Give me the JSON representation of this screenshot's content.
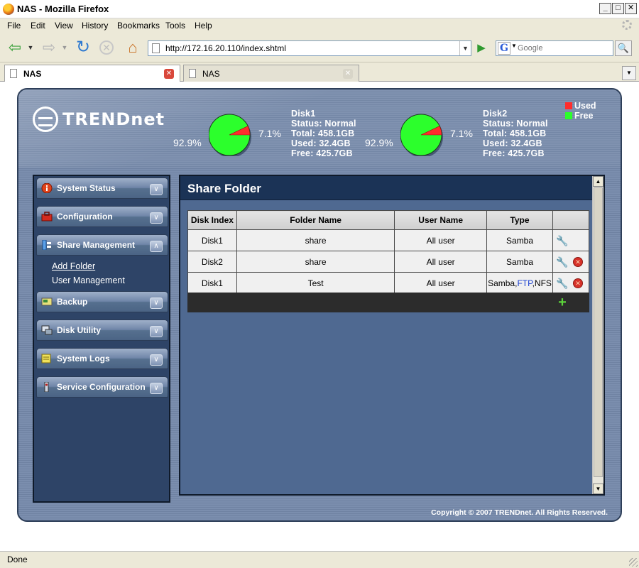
{
  "window": {
    "title": "NAS - Mozilla Firefox",
    "min": "_",
    "max": "□",
    "close": "✕"
  },
  "menu": [
    "File",
    "Edit",
    "View",
    "History",
    "Bookmarks",
    "Tools",
    "Help"
  ],
  "nav": {
    "url": "http://172.16.20.110/index.shtml",
    "search_placeholder": "Google"
  },
  "tabs": [
    {
      "label": "NAS",
      "active": true
    },
    {
      "label": "NAS",
      "active": false
    }
  ],
  "status": {
    "text": "Done"
  },
  "app": {
    "brand": "TRENDnet",
    "legend": {
      "used": "Used",
      "free": "Free"
    },
    "colors": {
      "used": "#ff2d2d",
      "free": "#2cff2c",
      "title_bar": "#1b3356",
      "panel": "#4f6991"
    },
    "disks": [
      {
        "name": "Disk1",
        "status": "Status: Normal",
        "total": "Total: 458.1GB",
        "used": "Used: 32.4GB",
        "free": "Free: 425.7GB",
        "used_pct": 7.1,
        "free_pct": 92.9,
        "used_label": "7.1%",
        "free_label": "92.9%"
      },
      {
        "name": "Disk2",
        "status": "Status: Normal",
        "total": "Total: 458.1GB",
        "used": "Used: 32.4GB",
        "free": "Free: 425.7GB",
        "used_pct": 7.1,
        "free_pct": 92.9,
        "used_label": "7.1%",
        "free_label": "92.9%"
      }
    ],
    "sidebar": {
      "items": [
        {
          "label": "System Status",
          "icon": "info-icon",
          "expanded": false
        },
        {
          "label": "Configuration",
          "icon": "toolbox-icon",
          "expanded": false
        },
        {
          "label": "Share Management",
          "icon": "share-icon",
          "expanded": true
        },
        {
          "label": "Backup",
          "icon": "backup-icon",
          "expanded": false
        },
        {
          "label": "Disk Utility",
          "icon": "disk-utility-icon",
          "expanded": false
        },
        {
          "label": "System Logs",
          "icon": "logs-icon",
          "expanded": false
        },
        {
          "label": "Service Configuration",
          "icon": "service-icon",
          "expanded": false
        }
      ],
      "submenu": [
        "Add Folder",
        "User Management"
      ]
    },
    "main": {
      "title": "Share Folder",
      "columns": [
        "Disk Index",
        "Folder Name",
        "User Name",
        "Type",
        ""
      ],
      "rows": [
        {
          "disk": "Disk1",
          "folder": "share",
          "user": "All user",
          "type": "Samba",
          "deletable": false
        },
        {
          "disk": "Disk2",
          "folder": "share",
          "user": "All user",
          "type": "Samba",
          "deletable": true
        },
        {
          "disk": "Disk1",
          "folder": "Test",
          "user": "All user",
          "type_parts": [
            "Samba",
            "FTP",
            "NFS"
          ],
          "deletable": true
        }
      ]
    },
    "copyright": "Copyright © 2007 TRENDnet. All Rights Reserved."
  }
}
